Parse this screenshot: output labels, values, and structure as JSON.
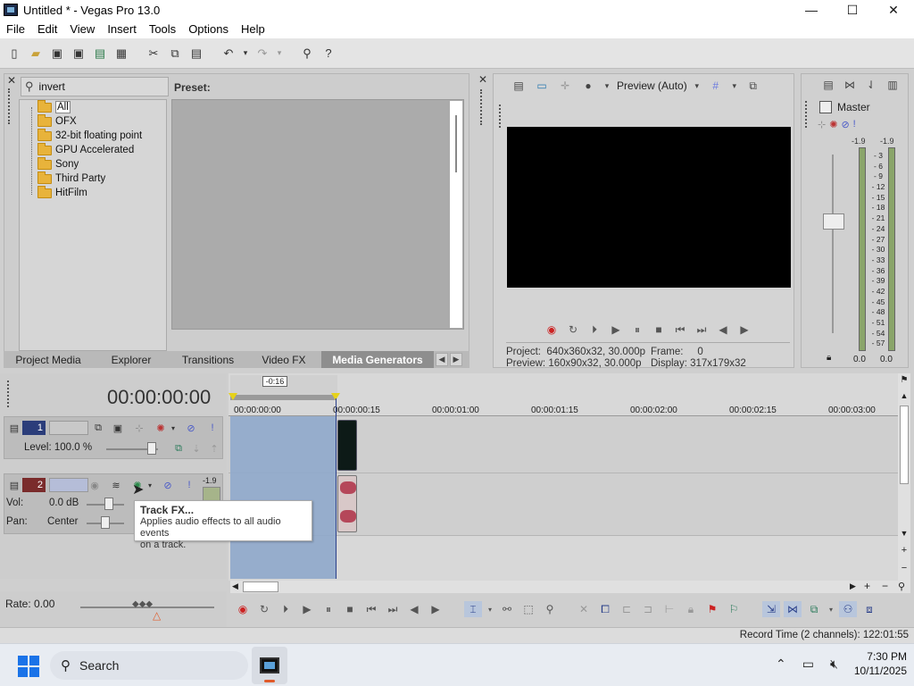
{
  "window": {
    "title": "Untitled * - Vegas Pro 13.0",
    "controls": {
      "minimize": "—",
      "maximize": "☐",
      "close": "✕"
    }
  },
  "menu": [
    "File",
    "Edit",
    "View",
    "Insert",
    "Tools",
    "Options",
    "Help"
  ],
  "fx_panel": {
    "search_value": "invert",
    "preset_label": "Preset:",
    "tree": [
      "All",
      "OFX",
      "32-bit floating point",
      "GPU Accelerated",
      "Sony",
      "Third Party",
      "HitFilm"
    ],
    "selected_tree_item": "All",
    "tabs": [
      "Project Media",
      "Explorer",
      "Transitions",
      "Video FX",
      "Media Generators"
    ],
    "active_tab": "Media Generators"
  },
  "preview": {
    "quality": "Preview (Auto)",
    "project_label": "Project:",
    "project_value": "640x360x32, 30.000p",
    "preview_label": "Preview:",
    "preview_value": "160x90x32, 30.000p",
    "frame_label": "Frame:",
    "frame_value": "0",
    "display_label": "Display:",
    "display_value": "317x179x32"
  },
  "master": {
    "label": "Master",
    "peak_left": "-1.9",
    "peak_right": "-1.9",
    "scale": [
      "3",
      "6",
      "9",
      "12",
      "15",
      "18",
      "21",
      "24",
      "27",
      "30",
      "33",
      "36",
      "39",
      "42",
      "45",
      "48",
      "51",
      "54",
      "57"
    ],
    "bottom_left": "0.0",
    "bottom_right": "0.0"
  },
  "timeline": {
    "timecode": "00:00:00:00",
    "cursor_label": "-0:16",
    "ruler": [
      "00:00:00:00",
      "00:00:00:15",
      "00:00:01:00",
      "00:00:01:15",
      "00:00:02:00",
      "00:00:02:15",
      "00:00:03:00"
    ],
    "video_track": {
      "number": "1",
      "level_label": "Level: 100.0 %"
    },
    "audio_track": {
      "number": "2",
      "vol_label": "Vol:",
      "vol_value": "0.0 dB",
      "pan_label": "Pan:",
      "pan_value": "Center",
      "meter_peak": "-1.9"
    },
    "rate": "Rate: 0.00"
  },
  "tooltip": {
    "title": "Track FX...",
    "desc_line1": "Applies audio effects to all audio events",
    "desc_line2": "on a track."
  },
  "status": {
    "record_time": "Record Time (2 channels): 122:01:55"
  },
  "taskbar": {
    "search_label": "Search",
    "time": "7:30 PM",
    "date": "10/11/2025"
  }
}
